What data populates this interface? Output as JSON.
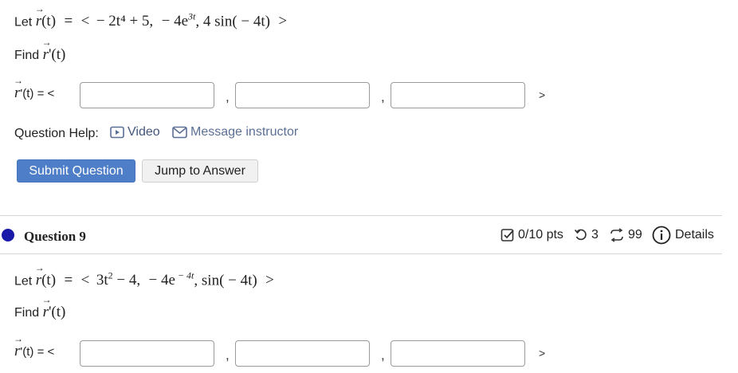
{
  "q8": {
    "let_prefix": "Let",
    "equals": "=",
    "vec_r": "r",
    "of_t": "(t)",
    "open": "<",
    "close": ">",
    "comp1": "− 2t⁴ + 5,",
    "comp2_a": "− 4e",
    "comp2_b": "3t",
    "comp3": ", 4 sin( − 4t)",
    "find": "Find",
    "find_expr": "'(t)",
    "answer_prefix": "'(t) = <",
    "comma": ",",
    "closing": ">"
  },
  "help": {
    "label": "Question Help:",
    "video": "Video",
    "message": "Message instructor"
  },
  "buttons": {
    "submit": "Submit Question",
    "jump": "Jump to Answer"
  },
  "q9": {
    "title": "Question 9",
    "score": "0/10 pts",
    "retries": "3",
    "versions": "99",
    "details": "Details",
    "let_prefix": "Let",
    "comp1_a": "3t",
    "comp1_b": "2",
    "comp1_c": " − 4,",
    "comp2_a": "− 4e",
    "comp2_b": " − 4t",
    "comp3": ", sin( − 4t)",
    "close": ">",
    "find": "Find",
    "find_expr": "'(t)",
    "answer_prefix": "'(t) = <",
    "closing": ">"
  },
  "colors": {
    "primary": "#4f7ec9",
    "link": "#5b6f95",
    "bullet": "#1a1aa8"
  }
}
